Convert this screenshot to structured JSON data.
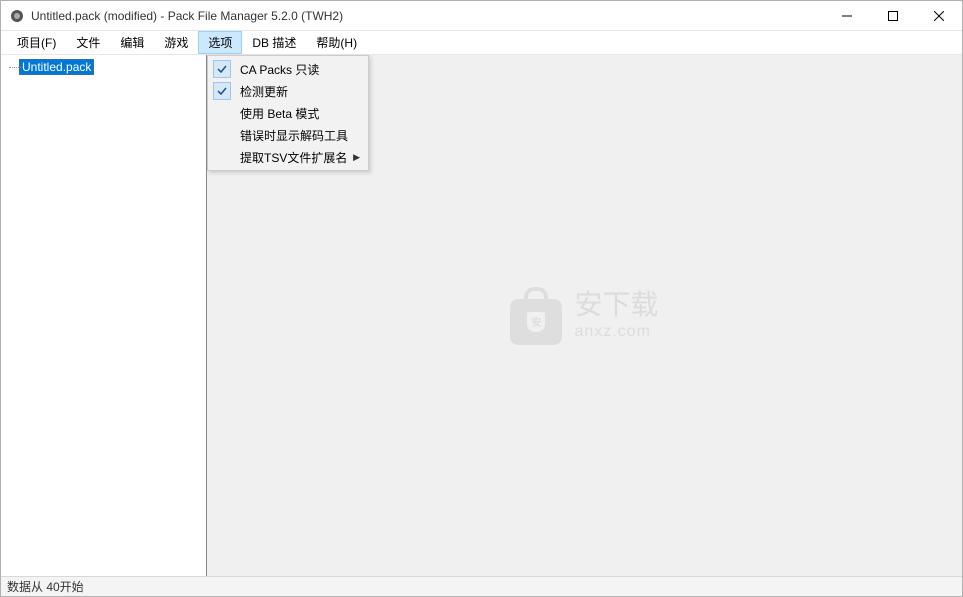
{
  "titlebar": {
    "title": "Untitled.pack (modified) - Pack File Manager 5.2.0 (TWH2)"
  },
  "menubar": {
    "items": [
      {
        "label": "项目(F)"
      },
      {
        "label": "文件"
      },
      {
        "label": "编辑"
      },
      {
        "label": "游戏"
      },
      {
        "label": "选项",
        "active": true
      },
      {
        "label": "DB 描述"
      },
      {
        "label": "帮助(H)"
      }
    ]
  },
  "dropdown": {
    "items": [
      {
        "label": "CA Packs 只读",
        "checked": true,
        "submenu": false
      },
      {
        "label": "检测更新",
        "checked": true,
        "submenu": false
      },
      {
        "label": "使用 Beta 模式",
        "checked": false,
        "submenu": false
      },
      {
        "label": "错误时显示解码工具",
        "checked": false,
        "submenu": false
      },
      {
        "label": "提取TSV文件扩展名",
        "checked": false,
        "submenu": true
      }
    ]
  },
  "tree": {
    "root": "Untitled.pack"
  },
  "watermark": {
    "cn": "安下载",
    "en": "anxz.com"
  },
  "statusbar": {
    "text": "数据从 40开始"
  }
}
